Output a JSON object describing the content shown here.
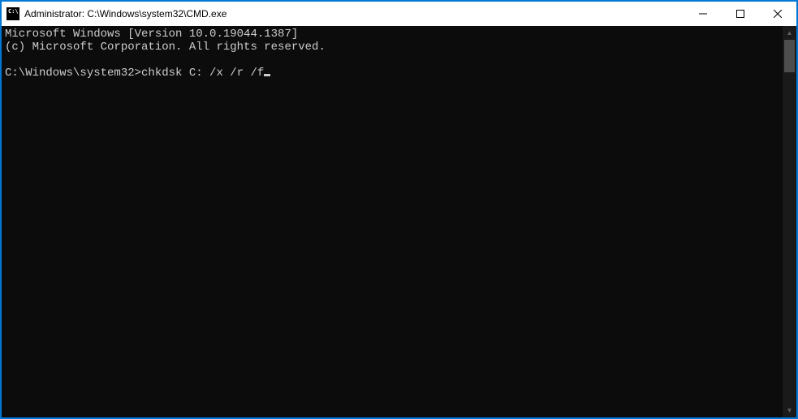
{
  "titlebar": {
    "icon_label": "C:\\",
    "title": "Administrator: C:\\Windows\\system32\\CMD.exe",
    "minimize": "—",
    "maximize": "□",
    "close": "✕"
  },
  "terminal": {
    "line1": "Microsoft Windows [Version 10.0.19044.1387]",
    "line2": "(c) Microsoft Corporation. All rights reserved.",
    "blank": "",
    "prompt": "C:\\Windows\\system32>",
    "command": "chkdsk C: /x /r /f"
  }
}
